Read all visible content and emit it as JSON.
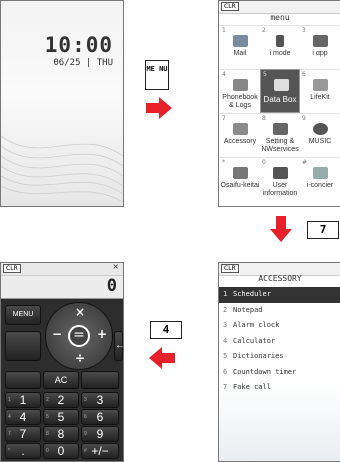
{
  "idle": {
    "time": "10:00",
    "date": "06/25 | THU"
  },
  "keys": {
    "menu": "ME NU",
    "seven": "7",
    "four": "4"
  },
  "menu": {
    "clr": "CLR",
    "title": "menu",
    "items": [
      {
        "num": "1",
        "label": "Mail",
        "color": "#7a8aa0"
      },
      {
        "num": "2",
        "label": "i mode",
        "color": "#555"
      },
      {
        "num": "3",
        "label": "i αpp",
        "color": "#666"
      },
      {
        "num": "4",
        "label": "Phonebook & Logs",
        "color": "#888"
      },
      {
        "num": "5",
        "label": "Data Box",
        "color": "#ddd"
      },
      {
        "num": "6",
        "label": "LifeKit",
        "color": "#999"
      },
      {
        "num": "7",
        "label": "Accessory",
        "color": "#8a8a8a"
      },
      {
        "num": "8",
        "label": "Setting & NWservices",
        "color": "#666"
      },
      {
        "num": "9",
        "label": "MUSIC",
        "color": "#555"
      },
      {
        "num": "*",
        "label": "Osaifu-keitai",
        "color": "#777"
      },
      {
        "num": "0",
        "label": "User information",
        "color": "#555"
      },
      {
        "num": "#",
        "label": "i-concier",
        "color": "#9aa"
      }
    ]
  },
  "accessory": {
    "clr": "CLR",
    "title": "ACCESSORY",
    "items": [
      {
        "num": "1",
        "label": "Scheduler"
      },
      {
        "num": "2",
        "label": "Notepad"
      },
      {
        "num": "3",
        "label": "Alarm clock"
      },
      {
        "num": "4",
        "label": "Calculator"
      },
      {
        "num": "5",
        "label": "Dictionaries"
      },
      {
        "num": "6",
        "label": "Countdown timer"
      },
      {
        "num": "7",
        "label": "Fake call"
      }
    ]
  },
  "calc": {
    "clr": "CLR",
    "display": "0",
    "close": "×",
    "menu": "MENU",
    "ops": {
      "times": "×",
      "minus": "−",
      "equals": "=",
      "plus": "+",
      "divide": "÷"
    },
    "back": "←",
    "ac": "AC",
    "keys": [
      {
        "main": "1",
        "sub": "1"
      },
      {
        "main": "2",
        "sub": "2"
      },
      {
        "main": "3",
        "sub": "3"
      },
      {
        "main": "4",
        "sub": "4"
      },
      {
        "main": "5",
        "sub": "5"
      },
      {
        "main": "6",
        "sub": "6"
      },
      {
        "main": "7",
        "sub": "7"
      },
      {
        "main": "8",
        "sub": "8"
      },
      {
        "main": "9",
        "sub": "9"
      },
      {
        "main": ".",
        "sub": "*"
      },
      {
        "main": "0",
        "sub": "0"
      },
      {
        "main": "+/−",
        "sub": "#"
      }
    ]
  },
  "colors": {
    "arrow": "#e8202a",
    "highlight": "#333333"
  }
}
